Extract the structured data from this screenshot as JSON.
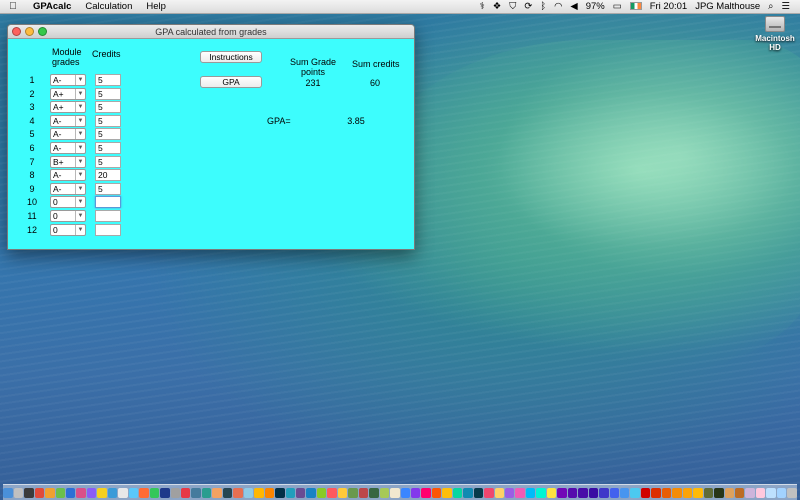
{
  "menubar": {
    "apple_icon": "",
    "app_name": "GPAcalc",
    "menus": [
      "Calculation",
      "Help"
    ],
    "battery": "97%",
    "clock": "Fri 20:01",
    "user": "JPG Malthouse",
    "status_icons": [
      "bluetooth-logo-icon",
      "dropbox-icon",
      "shield-icon",
      "sync-icon",
      "bluetooth-icon",
      "wifi-icon",
      "volume-icon",
      "battery-icon",
      "flag-ie-icon",
      "search-icon",
      "list-icon"
    ]
  },
  "desktop": {
    "hd_label": "Macintosh HD"
  },
  "window": {
    "title": "GPA calculated from grades",
    "headers": {
      "module_grades": "Module grades",
      "credits": "Credits",
      "sum_grade_points": "Sum Grade points",
      "sum_credits": "Sum credits",
      "gpa_label": "GPA="
    },
    "rows": [
      {
        "num": "1",
        "grade": "A-",
        "credits": "5"
      },
      {
        "num": "2",
        "grade": "A+",
        "credits": "5"
      },
      {
        "num": "3",
        "grade": "A+",
        "credits": "5"
      },
      {
        "num": "4",
        "grade": "A-",
        "credits": "5"
      },
      {
        "num": "5",
        "grade": "A-",
        "credits": "5"
      },
      {
        "num": "6",
        "grade": "A-",
        "credits": "5"
      },
      {
        "num": "7",
        "grade": "B+",
        "credits": "5"
      },
      {
        "num": "8",
        "grade": "A-",
        "credits": "20"
      },
      {
        "num": "9",
        "grade": "A-",
        "credits": "5"
      },
      {
        "num": "10",
        "grade": "0",
        "credits": ""
      },
      {
        "num": "11",
        "grade": "0",
        "credits": ""
      },
      {
        "num": "12",
        "grade": "0",
        "credits": ""
      }
    ],
    "buttons": {
      "instructions": "Instructions",
      "gpa": "GPA"
    },
    "results": {
      "sum_grade_points": "231",
      "sum_credits": "60",
      "gpa": "3.85"
    },
    "colors": {
      "window_bg": "#3dfdfd"
    }
  },
  "dock": {
    "icons": [
      "#4a90d9",
      "#c0c0c0",
      "#3b3b3b",
      "#e04a3a",
      "#f0a030",
      "#6bbf4a",
      "#2d6fd6",
      "#d94f8a",
      "#8b5cf6",
      "#f5d020",
      "#3a9bd8",
      "#e8e8e8",
      "#5ac8fa",
      "#ff6b35",
      "#34c759",
      "#1e3a8a",
      "#a0a0a0",
      "#e63946",
      "#457b9d",
      "#2a9d8f",
      "#f4a261",
      "#264653",
      "#e76f51",
      "#8ecae6",
      "#ffb703",
      "#fb8500",
      "#023047",
      "#219ebc",
      "#6a4c93",
      "#1982c4",
      "#8ac926",
      "#ff595e",
      "#ffca3a",
      "#6a994e",
      "#bc4749",
      "#386641",
      "#a7c957",
      "#f2e8cf",
      "#3a86ff",
      "#8338ec",
      "#ff006e",
      "#fb5607",
      "#ffbe0b",
      "#06d6a0",
      "#118ab2",
      "#073b4c",
      "#ef476f",
      "#ffd166",
      "#9b5de5",
      "#f15bb5",
      "#00bbf9",
      "#00f5d4",
      "#fee440",
      "#7209b7",
      "#560bad",
      "#480ca8",
      "#3a0ca3",
      "#3f37c9",
      "#4361ee",
      "#4895ef",
      "#4cc9f0",
      "#d00000",
      "#dc2f02",
      "#e85d04",
      "#f48c06",
      "#faa307",
      "#ffba08",
      "#606c38",
      "#283618",
      "#dda15e",
      "#bc6c25",
      "#cdb4db",
      "#ffc8dd",
      "#bde0fe",
      "#a2d2ff",
      "#c0c0c0"
    ]
  }
}
